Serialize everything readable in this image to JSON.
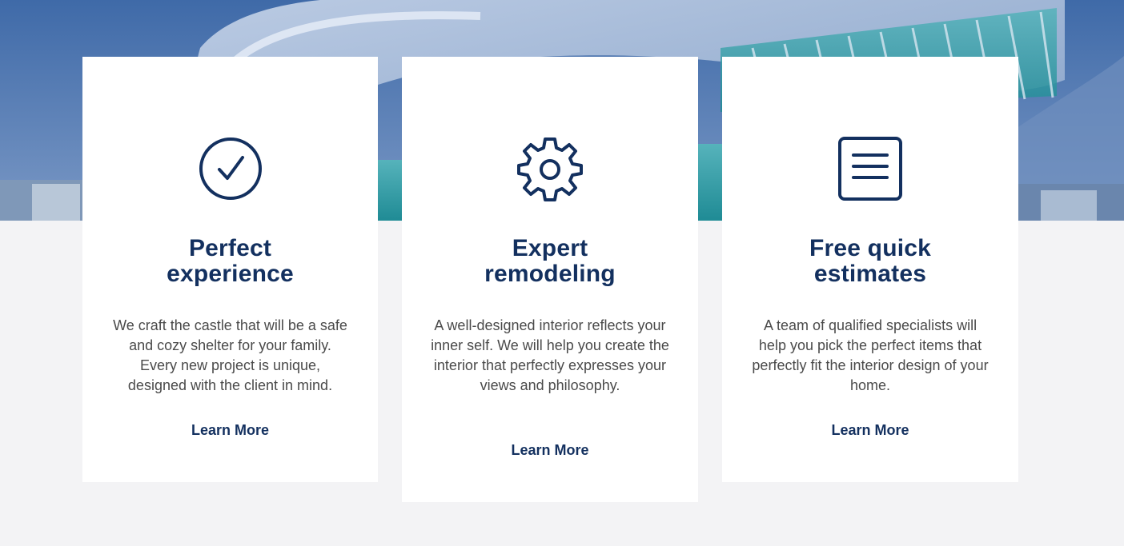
{
  "colors": {
    "accent": "#13305f",
    "body_text": "#4a4a4a",
    "page_background": "#f3f3f5",
    "card_background": "#ffffff"
  },
  "features": [
    {
      "icon": "check-circle-icon",
      "title_line1": "Perfect",
      "title_line2": "experience",
      "description": "We craft the castle that will be a safe and cozy shelter for your family. Every new project is unique, designed with the client in mind.",
      "link_label": "Learn More"
    },
    {
      "icon": "gear-icon",
      "title_line1": "Expert",
      "title_line2": "remodeling",
      "description": "A well-designed interior reflects your inner self. We will help you create the interior that perfectly expresses your views and philosophy.",
      "link_label": "Learn More"
    },
    {
      "icon": "document-lines-icon",
      "title_line1": "Free quick",
      "title_line2": "estimates",
      "description": "A team of qualified specialists will help you pick the perfect items that perfectly fit the interior design of your home.",
      "link_label": "Learn More"
    }
  ]
}
